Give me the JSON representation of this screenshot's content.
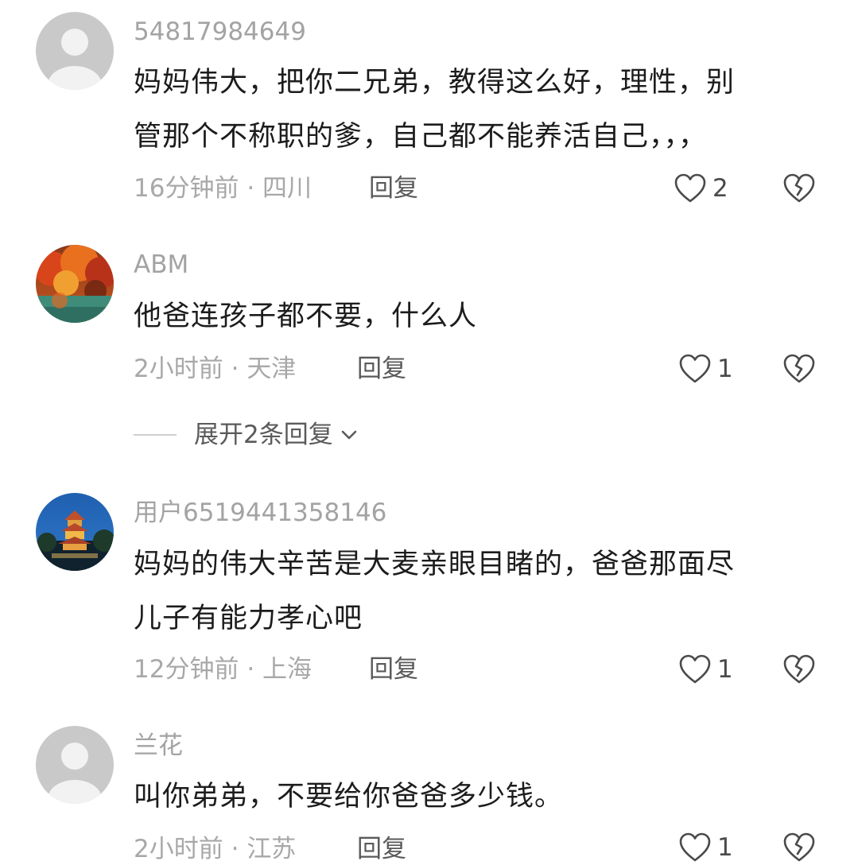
{
  "comments": [
    {
      "username": "54817984649",
      "avatar": "default-avatar",
      "lines": [
        "妈妈伟大，把你二兄弟，教得这么好，理性，别",
        "管那个不称职的爹，自己都不能养活自己，，，"
      ],
      "time": "16分钟前",
      "location": "四川",
      "reply": "回复",
      "likes": "2"
    },
    {
      "username": "ABM",
      "avatar": "autumn-lake-photo-avatar",
      "lines": [
        "他爸连孩子都不要，什么人"
      ],
      "time": "2小时前",
      "location": "天津",
      "reply": "回复",
      "likes": "1"
    },
    {
      "username": "用户6519441358146",
      "avatar": "night-pagoda-photo-avatar",
      "lines": [
        "妈妈的伟大辛苦是大麦亲眼目睹的，爸爸那面尽",
        "儿子有能力孝心吧"
      ],
      "time": "12分钟前",
      "location": "上海",
      "reply": "回复",
      "likes": "1"
    },
    {
      "username": "兰花",
      "avatar": "default-avatar",
      "lines": [
        "叫你弟弟，不要给你爸爸多少钱。"
      ],
      "time": "2小时前",
      "location": "江苏",
      "reply": "回复",
      "likes": "1"
    }
  ],
  "expand_replies": {
    "label": "展开2条回复",
    "icon": "chevron-down-icon"
  },
  "colors": {
    "text": "#1c1c1c",
    "muted": "#a3a3a3",
    "action": "#5a5a5a",
    "icon": "#4a4a4a"
  }
}
